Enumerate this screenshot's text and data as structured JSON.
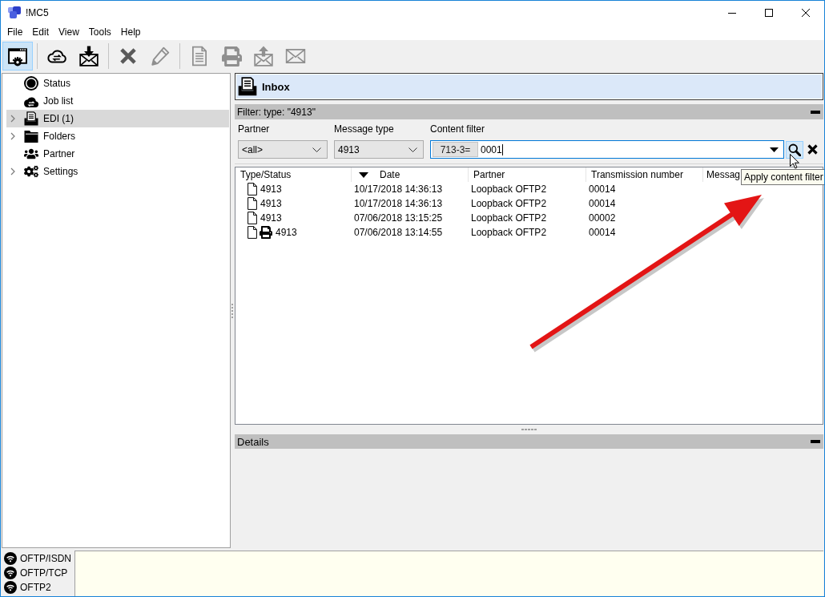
{
  "window": {
    "title": "!MC5"
  },
  "menu": [
    "File",
    "Edit",
    "View",
    "Tools",
    "Help"
  ],
  "toolbar": {
    "groups": [
      {
        "buttons": [
          {
            "selected": true,
            "disabled": false
          }
        ]
      },
      {
        "buttons": [
          {
            "selected": false,
            "disabled": false
          },
          {
            "selected": false,
            "disabled": false
          }
        ]
      },
      {
        "buttons": [
          {
            "selected": false,
            "disabled": false
          },
          {
            "selected": false,
            "disabled": true
          }
        ]
      },
      {
        "buttons": [
          {
            "selected": false,
            "disabled": true
          },
          {
            "selected": false,
            "disabled": true
          },
          {
            "selected": false,
            "disabled": true
          },
          {
            "selected": false,
            "disabled": true
          }
        ]
      }
    ]
  },
  "sidebar": {
    "items": [
      {
        "label": "Status",
        "expandable": false,
        "selected": false
      },
      {
        "label": "Job list",
        "expandable": false,
        "selected": false
      },
      {
        "label": "EDI (1)",
        "expandable": true,
        "selected": true
      },
      {
        "label": "Folders",
        "expandable": true,
        "selected": false
      },
      {
        "label": "Partner",
        "expandable": false,
        "selected": false
      },
      {
        "label": "Settings",
        "expandable": true,
        "selected": false
      }
    ]
  },
  "panel": {
    "title": "Inbox"
  },
  "filter": {
    "title": "Filter: type: \"4913\"",
    "partner": {
      "label": "Partner",
      "value": "<all>"
    },
    "message_type": {
      "label": "Message type",
      "value": "4913"
    },
    "content_filter": {
      "label": "Content filter",
      "tag": "713-3=",
      "value": "0001"
    },
    "search_hovered": true
  },
  "table": {
    "columns": [
      {
        "label": "Type/Status",
        "sorted": false
      },
      {
        "label": "Date",
        "sorted": true
      },
      {
        "label": "Partner",
        "sorted": false
      },
      {
        "label": "Transmission number",
        "sorted": false
      },
      {
        "label": "Messag",
        "sorted": false
      }
    ],
    "rows": [
      {
        "cells": [
          "4913",
          "10/17/2018 14:36:13",
          "Loopback OFTP2",
          "00014"
        ],
        "printed": false
      },
      {
        "cells": [
          "4913",
          "10/17/2018 14:36:13",
          "Loopback OFTP2",
          "00014"
        ],
        "printed": false
      },
      {
        "cells": [
          "4913",
          "07/06/2018 13:15:25",
          "Loopback OFTP2",
          "00002"
        ],
        "printed": false
      },
      {
        "cells": [
          "4913",
          "07/06/2018 13:14:55",
          "Loopback OFTP2",
          "00014"
        ],
        "printed": true
      }
    ]
  },
  "tooltip": "Apply content filter",
  "details": {
    "title": "Details"
  },
  "status_bar": {
    "connections": [
      {
        "label": "OFTP/ISDN"
      },
      {
        "label": "OFTP/TCP"
      },
      {
        "label": "OFTP2"
      }
    ]
  }
}
